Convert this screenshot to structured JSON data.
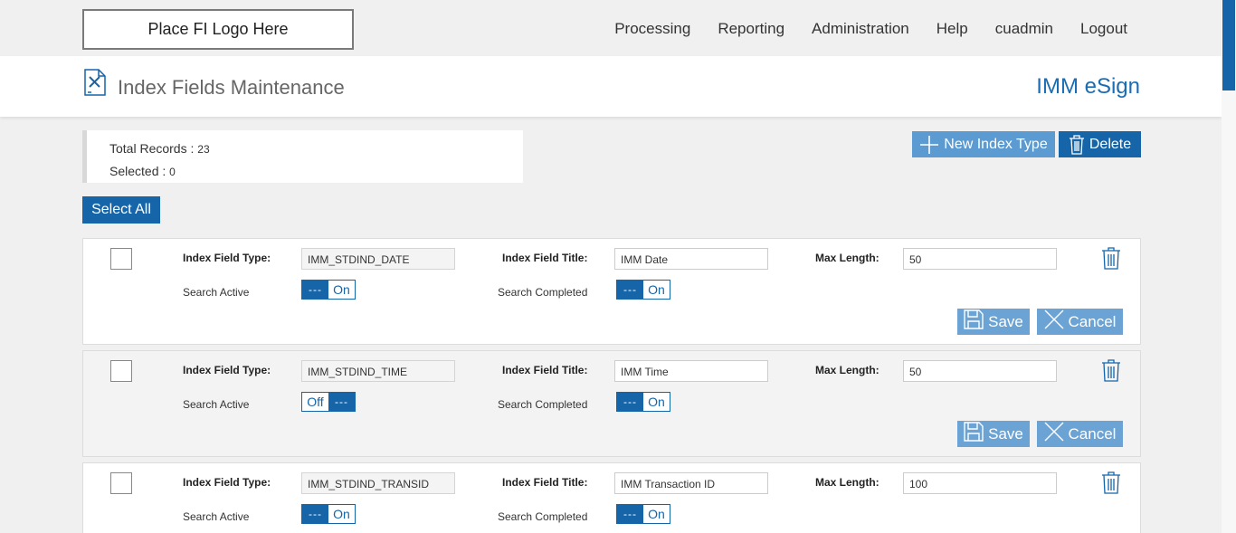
{
  "header": {
    "logo_text": "Place FI Logo Here",
    "nav": [
      "Processing",
      "Reporting",
      "Administration",
      "Help",
      "cuadmin",
      "Logout"
    ]
  },
  "page": {
    "title": "Index Fields Maintenance",
    "brand": "IMM eSign"
  },
  "summary": {
    "total_label": "Total Records : ",
    "total_value": "23",
    "selected_label": "Selected : ",
    "selected_value": "0"
  },
  "actions": {
    "new_label": "New Index Type",
    "delete_label": "Delete",
    "select_all_label": "Select All"
  },
  "labels": {
    "type": "Index Field Type:",
    "title": "Index Field Title:",
    "max": "Max Length:",
    "search_active": "Search Active",
    "search_completed": "Search Completed",
    "save": "Save",
    "cancel": "Cancel",
    "dots": "---"
  },
  "records": [
    {
      "type": "IMM_STDIND_DATE",
      "title": "IMM Date",
      "max": "50",
      "active": "On",
      "completed": "On"
    },
    {
      "type": "IMM_STDIND_TIME",
      "title": "IMM Time",
      "max": "50",
      "active": "Off",
      "completed": "On"
    },
    {
      "type": "IMM_STDIND_TRANSID",
      "title": "IMM Transaction ID",
      "max": "100",
      "active": "On",
      "completed": "On"
    }
  ],
  "colors": {
    "primary": "#1565a8",
    "secondary": "#5b9bd1",
    "brand_text": "#1a6db3"
  },
  "icons": [
    "file-tools-icon",
    "plus-icon",
    "trash-icon",
    "save-icon",
    "close-icon"
  ]
}
